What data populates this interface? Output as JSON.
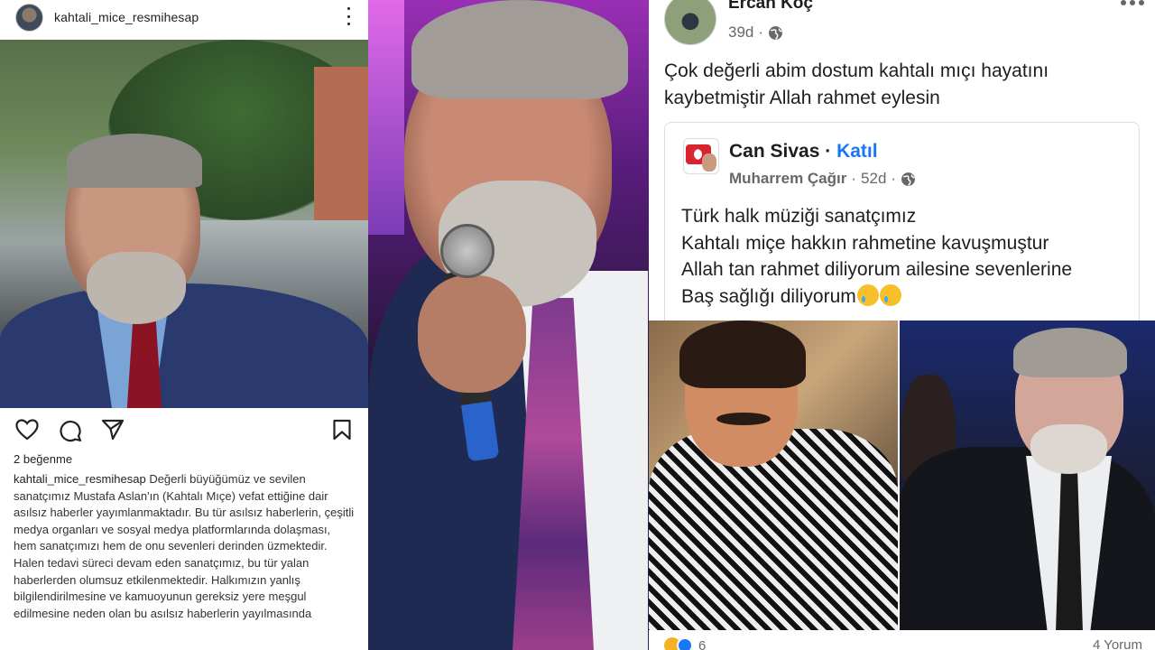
{
  "instagram": {
    "username": "kahtali_mice_resmihesap",
    "likes": "2 beğenme",
    "caption_username": "kahtali_mice_resmihesap",
    "caption_text": "Değerli büyüğümüz ve sevilen sanatçımız Mustafa Aslan'ın (Kahtalı Mıçe) vefat ettiğine dair asılsız haberler yayımlanmaktadır. Bu tür asılsız haberlerin, çeşitli medya organları ve sosyal medya platformlarında dolaşması, hem sanatçımızı hem de onu sevenleri derinden üzmektedir.",
    "caption_text_2": "Halen tedavi süreci devam eden sanatçımız, bu tür yalan haberlerden olumsuz etkilenmektedir. Halkımızın yanlış bilgilendirilmesine ve kamuoyunun gereksiz yere meşgul edilmesine neden olan bu asılsız haberlerin yayılmasında"
  },
  "facebook": {
    "author": "Ercan Koç",
    "time": "39d",
    "post_text": "Çok değerli abim dostum kahtalı mıçı hayatını kaybetmiştir Allah rahmet eylesin",
    "shared": {
      "group": "Can Sivas",
      "join_label": "Katıl",
      "author": "Muharrem Çağır",
      "time": "52d",
      "lines": [
        "Türk halk müziği sanatçımız",
        "Kahtalı miçe hakkın rahmetine kavuşmuştur",
        "Allah tan rahmet diliyorum ailesine sevenlerine",
        "Baş sağlığı diliyorum"
      ]
    },
    "reaction_count": "6",
    "comments": "4 Yorum"
  },
  "icons": {
    "ig": [
      "heart-icon",
      "comment-icon",
      "share-icon",
      "bookmark-icon",
      "more-icon"
    ],
    "fb": [
      "globe-icon",
      "more-icon",
      "crying-emoji-icon",
      "sad-reaction-icon",
      "care-reaction-icon"
    ]
  },
  "colors": {
    "fb_link": "#1877f2",
    "fb_meta": "#65676b",
    "text": "#1c1e21"
  }
}
